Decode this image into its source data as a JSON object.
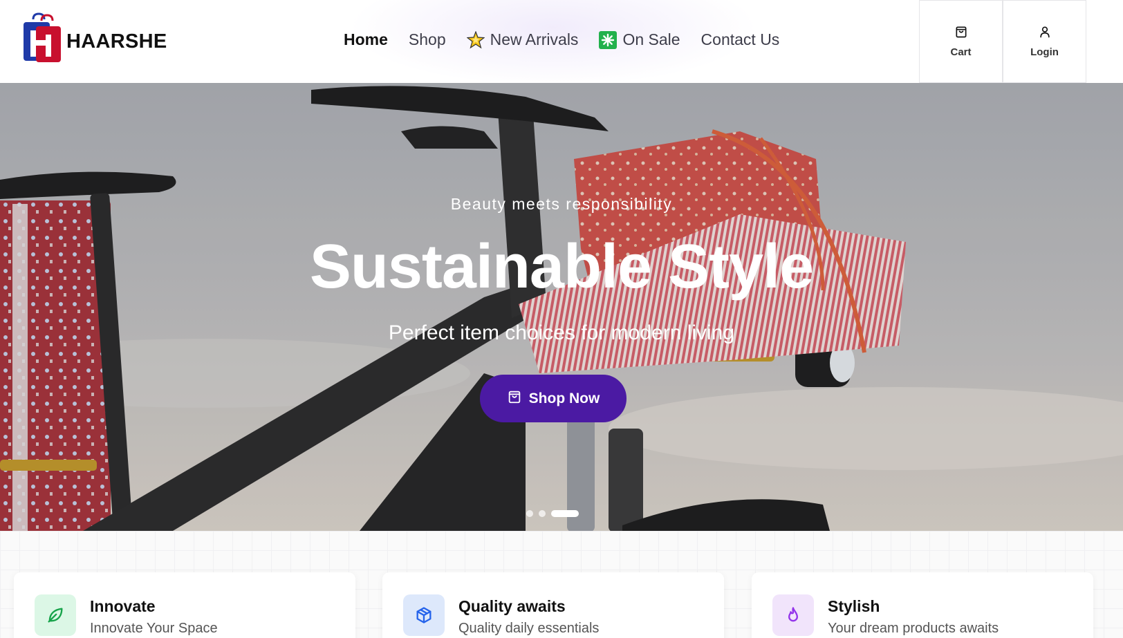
{
  "brand": {
    "name": "HAARSHE"
  },
  "nav": {
    "items": [
      {
        "label": "Home",
        "active": true
      },
      {
        "label": "Shop",
        "active": false
      },
      {
        "label": "New Arrivals",
        "icon": "sparkle-star-icon",
        "active": false
      },
      {
        "label": "On Sale",
        "icon": "eight-spoked-asterisk-icon",
        "active": false
      },
      {
        "label": "Contact Us",
        "active": false
      }
    ]
  },
  "header_actions": {
    "cart_label": "Cart",
    "login_label": "Login"
  },
  "hero": {
    "eyebrow": "Beauty meets responsibility",
    "title": "Sustainable Style",
    "subtitle": "Perfect item choices for modern living",
    "cta_label": "Shop Now",
    "slides_count": 3,
    "active_slide": 3
  },
  "features": [
    {
      "title": "Innovate",
      "subtitle": "Innovate Your Space",
      "icon": "leaf-icon",
      "color": "#16a34a"
    },
    {
      "title": "Quality awaits",
      "subtitle": "Quality daily essentials",
      "icon": "cube-icon",
      "color": "#2563eb"
    },
    {
      "title": "Stylish",
      "subtitle": "Your dream products awaits",
      "icon": "flame-icon",
      "color": "#9333ea"
    }
  ],
  "colors": {
    "primary": "#4b1aa3",
    "logo_blue": "#1f3aa8",
    "logo_red": "#c8102e"
  }
}
